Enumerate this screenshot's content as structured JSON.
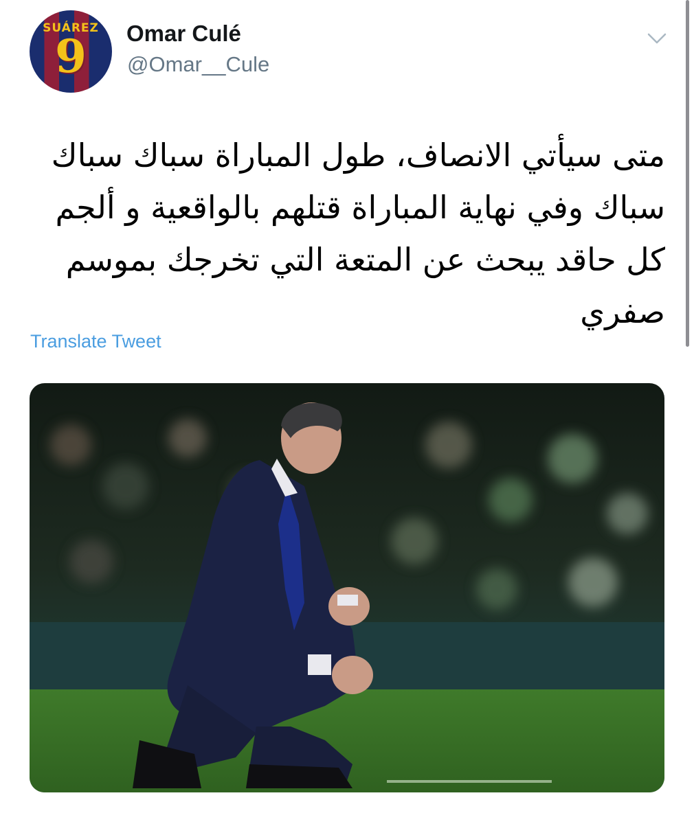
{
  "tweet": {
    "author": {
      "display_name": "Omar Culé",
      "handle": "@Omar__Cule",
      "avatar": {
        "jersey_name": "SUÁREZ",
        "jersey_number": "9"
      }
    },
    "menu_icon": "chevron-down-icon",
    "text": "متى سيأتي الانصاف، طول المباراة سباك سباك سباك وفي نهاية المباراة قتلهم بالواقعية و ألجم كل حاقد يبحث عن المتعة التي تخرجك بموسم صفري",
    "translate_label": "Translate Tweet",
    "media": {
      "type": "photo"
    }
  },
  "colors": {
    "name": "#14171a",
    "handle": "#657786",
    "link": "#4a9de0",
    "scrollbar": "#8e8e93"
  }
}
